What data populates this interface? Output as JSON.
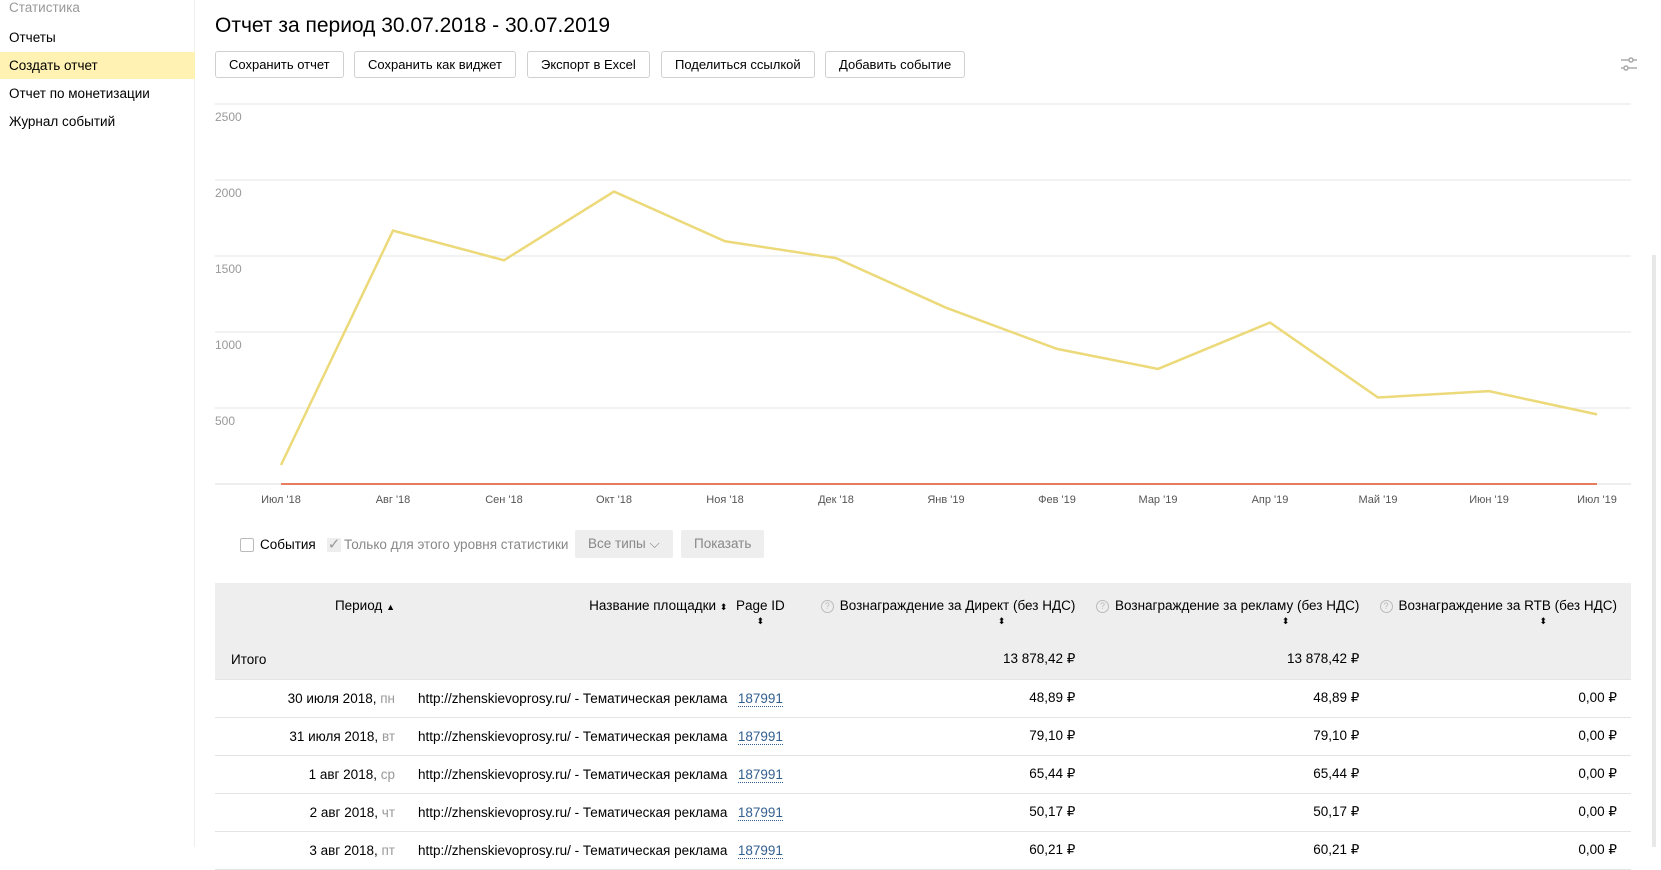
{
  "sidebar": {
    "header": "Статистика",
    "items": [
      {
        "label": "Отчеты"
      },
      {
        "label": "Создать отчет",
        "active": true
      },
      {
        "label": "Отчет по монетизации"
      },
      {
        "label": "Журнал событий"
      }
    ]
  },
  "header": {
    "title": "Отчет за период 30.07.2018 - 30.07.2019",
    "settings_icon": "sliders-icon"
  },
  "toolbar": {
    "save": "Сохранить отчет",
    "save_widget": "Сохранить как виджет",
    "export": "Экспорт в Excel",
    "share": "Поделиться ссылкой",
    "add_event": "Добавить событие"
  },
  "chart_data": {
    "type": "line",
    "title": "",
    "xlabel": "",
    "ylabel": "",
    "ylim": [
      0,
      2500
    ],
    "grid": true,
    "yticks": [
      "500",
      "1000",
      "1500",
      "2000",
      "2500"
    ],
    "categories": [
      "Июл '18",
      "Авг '18",
      "Сен '18",
      "Окт '18",
      "Ноя '18",
      "Дек '18",
      "Янв '19",
      "Фев '19",
      "Мар '19",
      "Апр '19",
      "Май '19",
      "Июн '19",
      "Июл '19"
    ],
    "series": [
      {
        "color": "#ecd97a",
        "values": [
          125,
          1667,
          1472,
          1924,
          1597,
          1486,
          1160,
          889,
          757,
          1062,
          569,
          611,
          458
        ]
      },
      {
        "color": "#e0502a",
        "values": [
          0,
          0,
          0,
          0,
          0,
          0,
          0,
          0,
          0,
          0,
          0,
          0,
          0
        ]
      }
    ]
  },
  "controls": {
    "events": "События",
    "events_checked": false,
    "only_level": "Только для этого уровня статистики",
    "only_level_checked": true,
    "types": "Все типы",
    "show": "Показать"
  },
  "table": {
    "headers": {
      "period": "Период",
      "site": "Название площадки",
      "page_id": "Page ID",
      "direct": "Вознаграждение за Директ (без НДС)",
      "ads": "Вознаграждение за рекламу (без НДС)",
      "rtb": "Вознаграждение за RTB (без НДС)"
    },
    "total": {
      "label": "Итого",
      "direct": "13 878,42 ₽",
      "ads": "13 878,42 ₽"
    },
    "rows": [
      {
        "date": "30 июля 2018,",
        "dow": "пн",
        "site": "http://zhenskievoprosy.ru/ - Тематическая реклама",
        "page_id": "187991",
        "direct": "48,89 ₽",
        "ads": "48,89 ₽",
        "rtb": "0,00 ₽"
      },
      {
        "date": "31 июля 2018,",
        "dow": "вт",
        "site": "http://zhenskievoprosy.ru/ - Тематическая реклама",
        "page_id": "187991",
        "direct": "79,10 ₽",
        "ads": "79,10 ₽",
        "rtb": "0,00 ₽"
      },
      {
        "date": "1 авг 2018,",
        "dow": "ср",
        "site": "http://zhenskievoprosy.ru/ - Тематическая реклама",
        "page_id": "187991",
        "direct": "65,44 ₽",
        "ads": "65,44 ₽",
        "rtb": "0,00 ₽"
      },
      {
        "date": "2 авг 2018,",
        "dow": "чт",
        "site": "http://zhenskievoprosy.ru/ - Тематическая реклама",
        "page_id": "187991",
        "direct": "50,17 ₽",
        "ads": "50,17 ₽",
        "rtb": "0,00 ₽"
      },
      {
        "date": "3 авг 2018,",
        "dow": "пт",
        "site": "http://zhenskievoprosy.ru/ - Тематическая реклама",
        "page_id": "187991",
        "direct": "60,21 ₽",
        "ads": "60,21 ₽",
        "rtb": "0,00 ₽"
      }
    ]
  }
}
